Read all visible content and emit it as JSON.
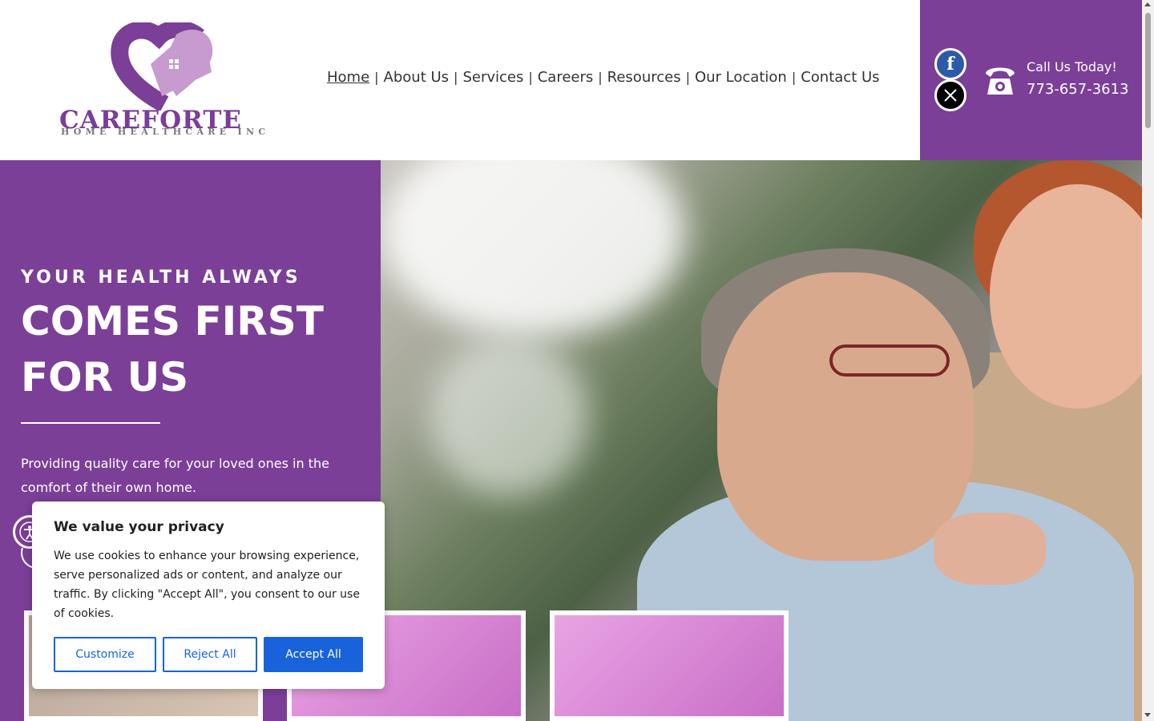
{
  "logo": {
    "title": "CAREFORTE",
    "subtitle": "HOME HEALTHCARE INC"
  },
  "nav": {
    "items": [
      {
        "label": "Home",
        "active": true
      },
      {
        "label": "About Us"
      },
      {
        "label": "Services"
      },
      {
        "label": "Careers"
      },
      {
        "label": "Resources"
      },
      {
        "label": "Our Location"
      },
      {
        "label": "Contact Us"
      }
    ],
    "separator": "|"
  },
  "contact": {
    "call_label": "Call Us Today!",
    "phone": "773-657-3613",
    "social": [
      "facebook-icon",
      "x-icon"
    ]
  },
  "hero": {
    "kicker": "YOUR HEALTH ALWAYS",
    "headline": "COMES FIRST FOR US",
    "text": "Providing quality care for your loved ones in the comfort of their own home."
  },
  "cookie": {
    "title": "We value your privacy",
    "text": "We use cookies to enhance your browsing experience, serve personalized ads or content, and analyze our traffic. By clicking \"Accept All\", you consent to our use of cookies.",
    "customize": "Customize",
    "reject": "Reject All",
    "accept": "Accept All"
  },
  "colors": {
    "brand_purple": "#7b3f98",
    "button_blue": "#1863dc",
    "card_pink": "#e9a4e4"
  }
}
